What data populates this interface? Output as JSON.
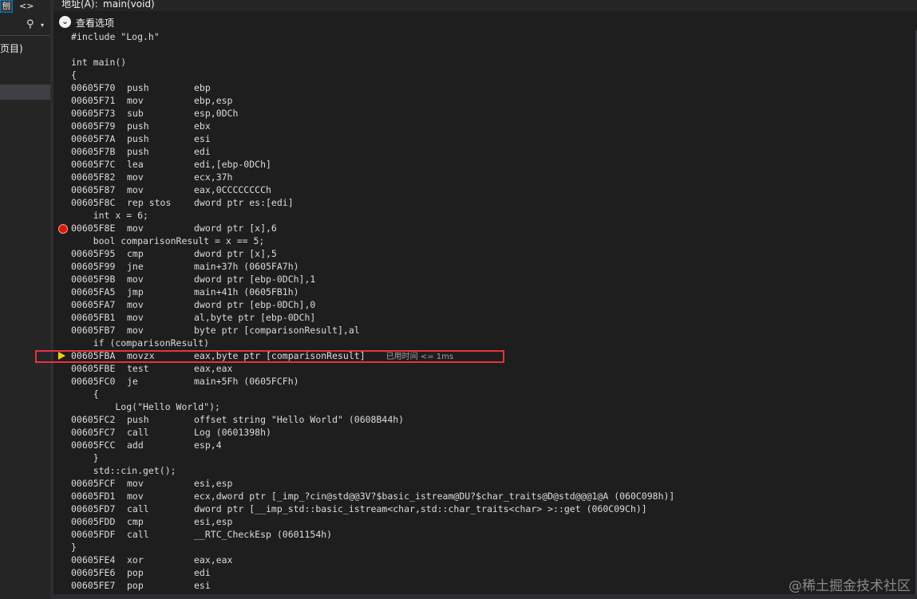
{
  "left_panel": {
    "tab1_label": "刨",
    "tab2_label": "<>",
    "search_icon": "⚲",
    "search_dropdown": "▾",
    "item_label": "页目)"
  },
  "address": {
    "label": "地址(A):",
    "value": "main(void)"
  },
  "view_options": {
    "icon": "chevron-down-icon",
    "label": "查看选项"
  },
  "code_lines": [
    {
      "kind": "src",
      "text": "#include \"Log.h\""
    },
    {
      "kind": "src",
      "text": ""
    },
    {
      "kind": "src",
      "text": "int main()"
    },
    {
      "kind": "src",
      "text": "{"
    },
    {
      "kind": "asm",
      "addr": "00605F70",
      "mn": "push",
      "op": "ebp"
    },
    {
      "kind": "asm",
      "addr": "00605F71",
      "mn": "mov",
      "op": "ebp,esp"
    },
    {
      "kind": "asm",
      "addr": "00605F73",
      "mn": "sub",
      "op": "esp,0DCh"
    },
    {
      "kind": "asm",
      "addr": "00605F79",
      "mn": "push",
      "op": "ebx"
    },
    {
      "kind": "asm",
      "addr": "00605F7A",
      "mn": "push",
      "op": "esi"
    },
    {
      "kind": "asm",
      "addr": "00605F7B",
      "mn": "push",
      "op": "edi"
    },
    {
      "kind": "asm",
      "addr": "00605F7C",
      "mn": "lea",
      "op": "edi,[ebp-0DCh]"
    },
    {
      "kind": "asm",
      "addr": "00605F82",
      "mn": "mov",
      "op": "ecx,37h"
    },
    {
      "kind": "asm",
      "addr": "00605F87",
      "mn": "mov",
      "op": "eax,0CCCCCCCCh"
    },
    {
      "kind": "asm",
      "addr": "00605F8C",
      "mn": "rep stos",
      "op": "dword ptr es:[edi]"
    },
    {
      "kind": "src",
      "text": "    int x = 6;"
    },
    {
      "kind": "asm",
      "addr": "00605F8E",
      "mn": "mov",
      "op": "dword ptr [x],6"
    },
    {
      "kind": "src",
      "text": "    bool comparisonResult = x == 5;"
    },
    {
      "kind": "asm",
      "addr": "00605F95",
      "mn": "cmp",
      "op": "dword ptr [x],5"
    },
    {
      "kind": "asm",
      "addr": "00605F99",
      "mn": "jne",
      "op": "main+37h (0605FA7h)"
    },
    {
      "kind": "asm",
      "addr": "00605F9B",
      "mn": "mov",
      "op": "dword ptr [ebp-0DCh],1"
    },
    {
      "kind": "asm",
      "addr": "00605FA5",
      "mn": "jmp",
      "op": "main+41h (0605FB1h)"
    },
    {
      "kind": "asm",
      "addr": "00605FA7",
      "mn": "mov",
      "op": "dword ptr [ebp-0DCh],0"
    },
    {
      "kind": "asm",
      "addr": "00605FB1",
      "mn": "mov",
      "op": "al,byte ptr [ebp-0DCh]"
    },
    {
      "kind": "asm",
      "addr": "00605FB7",
      "mn": "mov",
      "op": "byte ptr [comparisonResult],al"
    },
    {
      "kind": "src",
      "text": "    if (comparisonResult)"
    },
    {
      "kind": "asm",
      "addr": "00605FBA",
      "mn": "movzx",
      "op": "eax,byte ptr [comparisonResult]",
      "note": "已用时间 <= 1ms"
    },
    {
      "kind": "asm",
      "addr": "00605FBE",
      "mn": "test",
      "op": "eax,eax"
    },
    {
      "kind": "asm",
      "addr": "00605FC0",
      "mn": "je",
      "op": "main+5Fh (0605FCFh)"
    },
    {
      "kind": "src",
      "text": "    {"
    },
    {
      "kind": "src",
      "text": "        Log(\"Hello World\");"
    },
    {
      "kind": "asm",
      "addr": "00605FC2",
      "mn": "push",
      "op": "offset string \"Hello World\" (0608B44h)"
    },
    {
      "kind": "asm",
      "addr": "00605FC7",
      "mn": "call",
      "op": "Log (0601398h)"
    },
    {
      "kind": "asm",
      "addr": "00605FCC",
      "mn": "add",
      "op": "esp,4"
    },
    {
      "kind": "src",
      "text": "    }"
    },
    {
      "kind": "src",
      "text": "    std::cin.get();"
    },
    {
      "kind": "asm",
      "addr": "00605FCF",
      "mn": "mov",
      "op": "esi,esp"
    },
    {
      "kind": "asm",
      "addr": "00605FD1",
      "mn": "mov",
      "op": "ecx,dword ptr [_imp_?cin@std@@3V?$basic_istream@DU?$char_traits@D@std@@@1@A (060C098h)]"
    },
    {
      "kind": "asm",
      "addr": "00605FD7",
      "mn": "call",
      "op": "dword ptr [__imp_std::basic_istream<char,std::char_traits<char> >::get (060C09Ch)]"
    },
    {
      "kind": "asm",
      "addr": "00605FDD",
      "mn": "cmp",
      "op": "esi,esp"
    },
    {
      "kind": "asm",
      "addr": "00605FDF",
      "mn": "call",
      "op": "__RTC_CheckEsp (0601154h)"
    },
    {
      "kind": "src",
      "text": "}"
    },
    {
      "kind": "asm",
      "addr": "00605FE4",
      "mn": "xor",
      "op": "eax,eax"
    },
    {
      "kind": "asm",
      "addr": "00605FE6",
      "mn": "pop",
      "op": "edi"
    },
    {
      "kind": "asm",
      "addr": "00605FE7",
      "mn": "pop",
      "op": "esi"
    }
  ],
  "markers": {
    "breakpoint_icon": "breakpoint-icon",
    "current_line_icon": "current-instruction-arrow-icon"
  },
  "watermark": "@稀土掘金技术社区",
  "colors": {
    "background": "#1e1e1e",
    "breakpoint": "#e51400",
    "current_arrow": "#ffcc00",
    "highlight_border": "#e8333c"
  }
}
